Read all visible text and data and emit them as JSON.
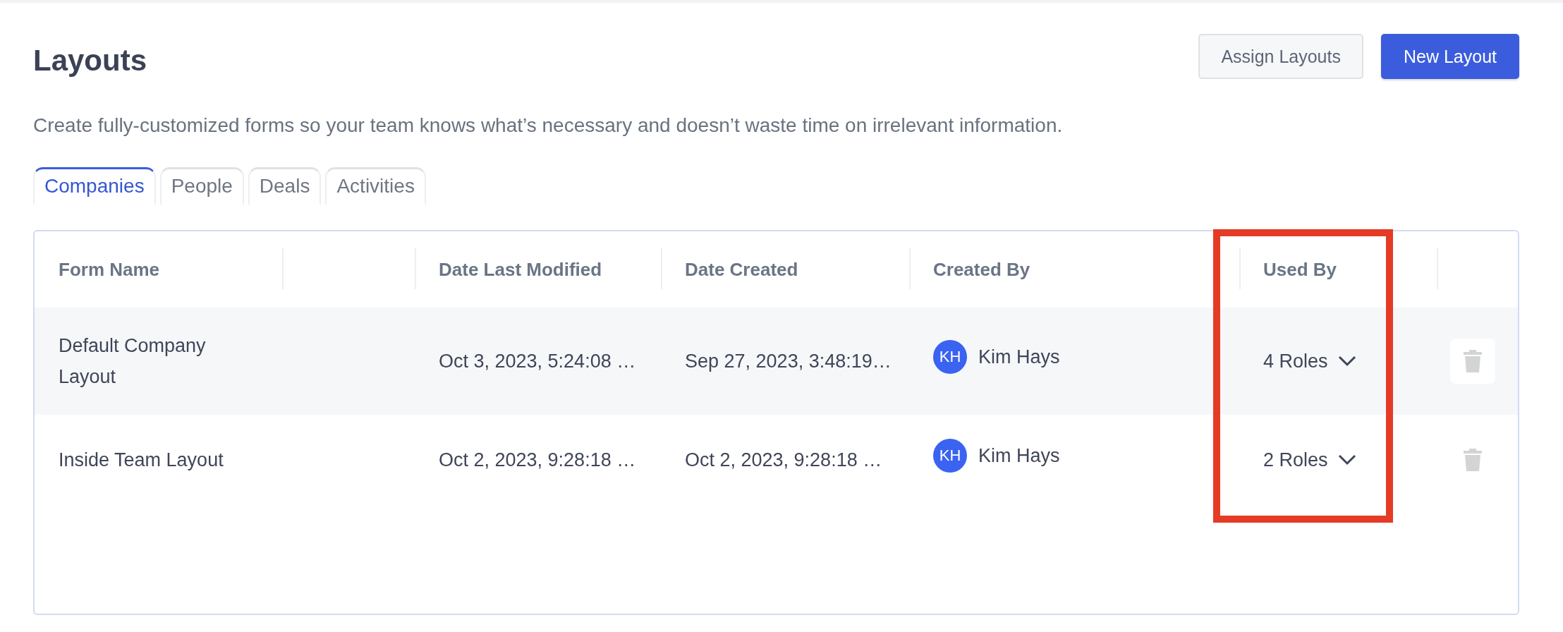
{
  "header": {
    "title": "Layouts",
    "buttons": [
      {
        "label": "Assign Layouts",
        "kind": "secondary"
      },
      {
        "label": "New Layout",
        "kind": "primary"
      }
    ]
  },
  "description": "Create fully-customized forms so your team knows what’s necessary and doesn’t waste time on irrelevant information.",
  "tabs": [
    {
      "label": "Companies",
      "selected": true
    },
    {
      "label": "People",
      "selected": false
    },
    {
      "label": "Deals",
      "selected": false
    },
    {
      "label": "Activities",
      "selected": false
    }
  ],
  "table": {
    "columns": [
      {
        "kind": "text",
        "label": "Form Name",
        "highlighted": false
      },
      {
        "kind": "spacer",
        "highlighted": false
      },
      {
        "kind": "text",
        "label": "Date Last Modified",
        "highlighted": false
      },
      {
        "kind": "text",
        "label": "Date Created",
        "highlighted": false
      },
      {
        "kind": "text",
        "label": "Created By",
        "highlighted": false
      },
      {
        "kind": "text",
        "label": "Used By",
        "highlighted": true
      },
      {
        "kind": "spacer",
        "highlighted": false
      }
    ],
    "rows": [
      {
        "name": "Default Company Layout",
        "modified": "Oct 3, 2023, 5:24:08 …",
        "created": "Sep 27, 2023, 3:48:19…",
        "creator": {
          "initials": "KH",
          "name": "Kim Hays"
        },
        "used_by": "4 Roles",
        "hovered": true
      },
      {
        "name": "Inside Team Layout",
        "modified": "Oct 2, 2023, 9:28:18 …",
        "created": "Oct 2, 2023, 9:28:18 …",
        "creator": {
          "initials": "KH",
          "name": "Kim Hays"
        },
        "used_by": "2 Roles",
        "hovered": false
      }
    ]
  }
}
